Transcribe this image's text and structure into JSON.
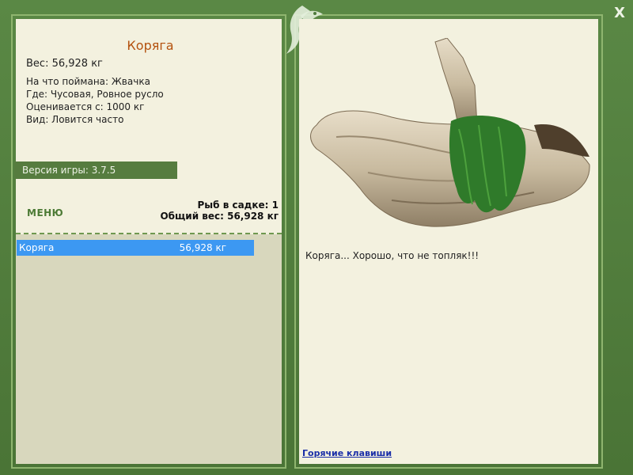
{
  "window": {
    "close_label": "X"
  },
  "catch_info": {
    "name": "Коряга",
    "weight": "Вес: 56,928 кг",
    "bait": "На что поймана: Жвачка",
    "place": "Где: Чусовая, Ровное русло",
    "valued_from": "Оценивается с: 1000 кг",
    "kind": "Вид: Ловится часто"
  },
  "version": {
    "label": "Версия игры: 3.7.5"
  },
  "menu": {
    "label": "МЕНЮ"
  },
  "keepnet": {
    "count": "Рыб в садке: 1",
    "total_weight": "Общий вес: 56,928 кг",
    "items": [
      {
        "name": "Коряга",
        "weight": "56,928 кг"
      }
    ]
  },
  "description": {
    "text": "Коряга... Хорошо, что не топляк!!!"
  },
  "footer": {
    "hotkeys": "Горячие клавиши"
  },
  "icons": {
    "logo": "fish-leaf-logo-icon",
    "close": "close-icon",
    "driftwood": "driftwood-image"
  },
  "colors": {
    "frame": "#4e7a3c",
    "panel": "#f3f1df",
    "list_bg": "#d8d7bd",
    "fish_name": "#b4520f",
    "selection": "#3c98f2",
    "version_bar": "#567c3f"
  }
}
